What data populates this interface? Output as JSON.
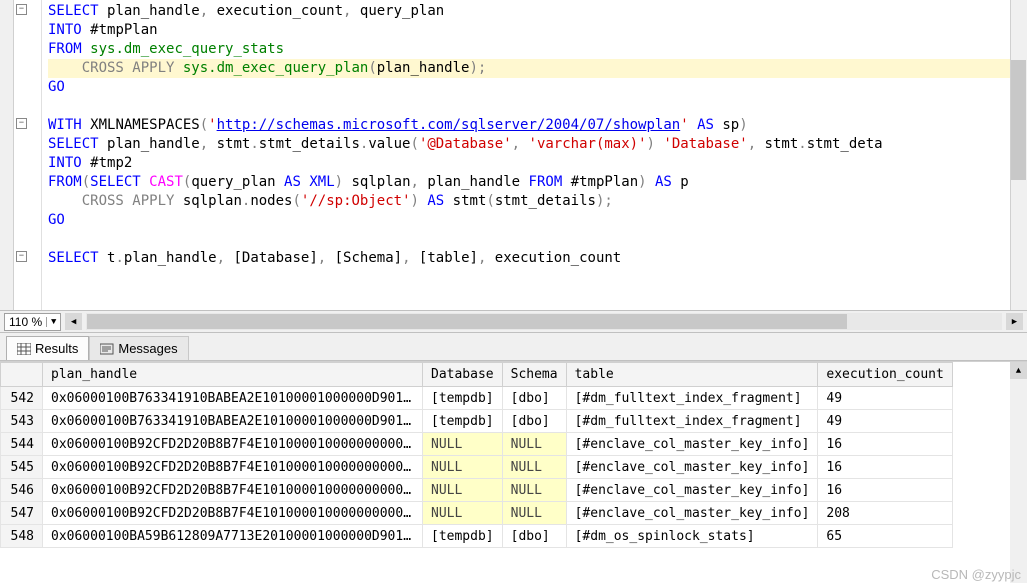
{
  "editor": {
    "lines": [
      {
        "tokens": [
          {
            "t": "SELECT ",
            "c": "kw-blue"
          },
          {
            "t": "plan_handle",
            "c": ""
          },
          {
            "t": ", ",
            "c": "kw-gray"
          },
          {
            "t": "execution_count",
            "c": ""
          },
          {
            "t": ", ",
            "c": "kw-gray"
          },
          {
            "t": "query_plan",
            "c": ""
          }
        ]
      },
      {
        "tokens": [
          {
            "t": "INTO ",
            "c": "kw-blue"
          },
          {
            "t": "#tmpPlan",
            "c": ""
          }
        ]
      },
      {
        "tokens": [
          {
            "t": "FROM ",
            "c": "kw-blue"
          },
          {
            "t": "sys.dm_exec_query_stats",
            "c": "kw-green"
          }
        ]
      },
      {
        "tokens": [
          {
            "t": "    ",
            "c": ""
          },
          {
            "t": "CROSS APPLY ",
            "c": "kw-gray"
          },
          {
            "t": "sys.dm_exec_query_plan",
            "c": "kw-green"
          },
          {
            "t": "(",
            "c": "kw-gray"
          },
          {
            "t": "plan_handle",
            "c": ""
          },
          {
            "t": ");",
            "c": "kw-gray"
          }
        ],
        "hl": true
      },
      {
        "tokens": [
          {
            "t": "GO",
            "c": "kw-blue"
          }
        ]
      },
      {
        "tokens": [
          {
            "t": " ",
            "c": ""
          }
        ]
      },
      {
        "tokens": [
          {
            "t": "WITH ",
            "c": "kw-blue"
          },
          {
            "t": "XMLNAMESPACES",
            "c": ""
          },
          {
            "t": "(",
            "c": "kw-gray"
          },
          {
            "t": "'",
            "c": "kw-str"
          },
          {
            "t": "http://schemas.microsoft.com/sqlserver/2004/07/showplan",
            "c": "kw-url"
          },
          {
            "t": "'",
            "c": "kw-str"
          },
          {
            "t": " AS ",
            "c": "kw-blue"
          },
          {
            "t": "sp",
            "c": ""
          },
          {
            "t": ")",
            "c": "kw-gray"
          }
        ]
      },
      {
        "tokens": [
          {
            "t": "SELECT ",
            "c": "kw-blue"
          },
          {
            "t": "plan_handle",
            "c": ""
          },
          {
            "t": ", ",
            "c": "kw-gray"
          },
          {
            "t": "stmt",
            "c": ""
          },
          {
            "t": ".",
            "c": "kw-gray"
          },
          {
            "t": "stmt_details",
            "c": ""
          },
          {
            "t": ".",
            "c": "kw-gray"
          },
          {
            "t": "value",
            "c": ""
          },
          {
            "t": "(",
            "c": "kw-gray"
          },
          {
            "t": "'@Database'",
            "c": "kw-str"
          },
          {
            "t": ", ",
            "c": "kw-gray"
          },
          {
            "t": "'varchar(max)'",
            "c": "kw-str"
          },
          {
            "t": ") ",
            "c": "kw-gray"
          },
          {
            "t": "'Database'",
            "c": "kw-str"
          },
          {
            "t": ", ",
            "c": "kw-gray"
          },
          {
            "t": "stmt",
            "c": ""
          },
          {
            "t": ".",
            "c": "kw-gray"
          },
          {
            "t": "stmt_deta",
            "c": ""
          }
        ]
      },
      {
        "tokens": [
          {
            "t": "INTO ",
            "c": "kw-blue"
          },
          {
            "t": "#tmp2",
            "c": ""
          }
        ]
      },
      {
        "tokens": [
          {
            "t": "FROM",
            "c": "kw-blue"
          },
          {
            "t": "(",
            "c": "kw-gray"
          },
          {
            "t": "SELECT ",
            "c": "kw-blue"
          },
          {
            "t": "CAST",
            "c": "kw-func"
          },
          {
            "t": "(",
            "c": "kw-gray"
          },
          {
            "t": "query_plan ",
            "c": ""
          },
          {
            "t": "AS ",
            "c": "kw-blue"
          },
          {
            "t": "XML",
            "c": "kw-blue"
          },
          {
            "t": ") ",
            "c": "kw-gray"
          },
          {
            "t": "sqlplan",
            "c": ""
          },
          {
            "t": ", ",
            "c": "kw-gray"
          },
          {
            "t": "plan_handle ",
            "c": ""
          },
          {
            "t": "FROM ",
            "c": "kw-blue"
          },
          {
            "t": "#tmpPlan",
            "c": ""
          },
          {
            "t": ") ",
            "c": "kw-gray"
          },
          {
            "t": "AS ",
            "c": "kw-blue"
          },
          {
            "t": "p",
            "c": ""
          }
        ]
      },
      {
        "tokens": [
          {
            "t": "    ",
            "c": ""
          },
          {
            "t": "CROSS APPLY ",
            "c": "kw-gray"
          },
          {
            "t": "sqlplan",
            "c": ""
          },
          {
            "t": ".",
            "c": "kw-gray"
          },
          {
            "t": "nodes",
            "c": ""
          },
          {
            "t": "(",
            "c": "kw-gray"
          },
          {
            "t": "'//sp:Object'",
            "c": "kw-str"
          },
          {
            "t": ") ",
            "c": "kw-gray"
          },
          {
            "t": "AS ",
            "c": "kw-blue"
          },
          {
            "t": "stmt",
            "c": ""
          },
          {
            "t": "(",
            "c": "kw-gray"
          },
          {
            "t": "stmt_details",
            "c": ""
          },
          {
            "t": ");",
            "c": "kw-gray"
          }
        ]
      },
      {
        "tokens": [
          {
            "t": "GO",
            "c": "kw-blue"
          }
        ]
      },
      {
        "tokens": [
          {
            "t": " ",
            "c": ""
          }
        ]
      },
      {
        "tokens": [
          {
            "t": "SELECT ",
            "c": "kw-blue"
          },
          {
            "t": "t",
            "c": ""
          },
          {
            "t": ".",
            "c": "kw-gray"
          },
          {
            "t": "plan_handle",
            "c": ""
          },
          {
            "t": ", ",
            "c": "kw-gray"
          },
          {
            "t": "[Database]",
            "c": ""
          },
          {
            "t": ", ",
            "c": "kw-gray"
          },
          {
            "t": "[Schema]",
            "c": ""
          },
          {
            "t": ", ",
            "c": "kw-gray"
          },
          {
            "t": "[table]",
            "c": ""
          },
          {
            "t": ", ",
            "c": "kw-gray"
          },
          {
            "t": "execution_count",
            "c": ""
          }
        ]
      }
    ],
    "outline_toggles": [
      0,
      6,
      13
    ],
    "zoom": "110 %"
  },
  "tabs": {
    "results": "Results",
    "messages": "Messages"
  },
  "grid": {
    "columns": [
      "plan_handle",
      "Database",
      "Schema",
      "table",
      "execution_count"
    ],
    "rows": [
      {
        "n": "542",
        "h": "0x06000100B763341910BABEA2E10100001000000D9010...",
        "db": "[tempdb]",
        "sc": "[dbo]",
        "tb": "[#dm_fulltext_index_fragment]",
        "ec": "49"
      },
      {
        "n": "543",
        "h": "0x06000100B763341910BABEA2E10100001000000D9010...",
        "db": "[tempdb]",
        "sc": "[dbo]",
        "tb": "[#dm_fulltext_index_fragment]",
        "ec": "49"
      },
      {
        "n": "544",
        "h": "0x06000100B92CFD2D20B8B7F4E10100001000000000000...",
        "db": "NULL",
        "sc": "NULL",
        "tb": "[#enclave_col_master_key_info]",
        "ec": "16"
      },
      {
        "n": "545",
        "h": "0x06000100B92CFD2D20B8B7F4E10100001000000000000...",
        "db": "NULL",
        "sc": "NULL",
        "tb": "[#enclave_col_master_key_info]",
        "ec": "16"
      },
      {
        "n": "546",
        "h": "0x06000100B92CFD2D20B8B7F4E10100001000000000000...",
        "db": "NULL",
        "sc": "NULL",
        "tb": "[#enclave_col_master_key_info]",
        "ec": "16"
      },
      {
        "n": "547",
        "h": "0x06000100B92CFD2D20B8B7F4E10100001000000000000...",
        "db": "NULL",
        "sc": "NULL",
        "tb": "[#enclave_col_master_key_info]",
        "ec": "208"
      },
      {
        "n": "548",
        "h": "0x06000100BA59B612809A7713E20100001000000D9010...",
        "db": "[tempdb]",
        "sc": "[dbo]",
        "tb": "[#dm_os_spinlock_stats]",
        "ec": "65"
      }
    ]
  },
  "watermark": "CSDN @zyypjc"
}
